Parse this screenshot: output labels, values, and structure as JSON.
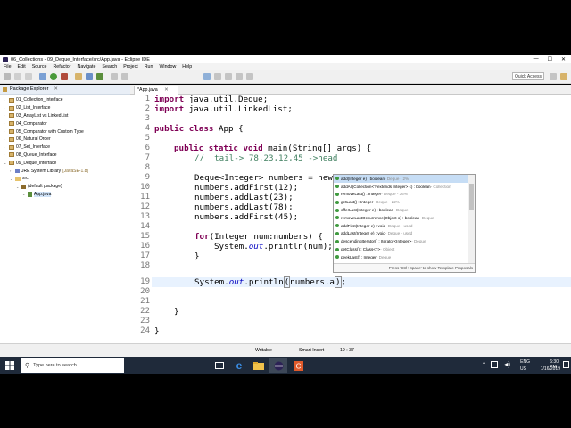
{
  "window": {
    "title": "06_Collections - 09_Deque_Interface/src/App.java - Eclipse IDE",
    "controls": [
      "—",
      "☐",
      "✕"
    ]
  },
  "menu": [
    "File",
    "Edit",
    "Source",
    "Refactor",
    "Navigate",
    "Search",
    "Project",
    "Run",
    "Window",
    "Help"
  ],
  "toolbar": {
    "quick_access": "Quick Access"
  },
  "package_explorer": {
    "title": "Package Explorer",
    "items": [
      {
        "label": "01_Collection_Interface",
        "indent": 0,
        "type": "project"
      },
      {
        "label": "02_List_Interface",
        "indent": 0,
        "type": "project"
      },
      {
        "label": "03_ArrayList vs LinkedList",
        "indent": 0,
        "type": "project"
      },
      {
        "label": "04_Comparator",
        "indent": 0,
        "type": "project"
      },
      {
        "label": "05_Comparator with Custom Type",
        "indent": 0,
        "type": "project"
      },
      {
        "label": "06_Natural Order",
        "indent": 0,
        "type": "project"
      },
      {
        "label": "07_Set_Interface",
        "indent": 0,
        "type": "project"
      },
      {
        "label": "08_Queue_Interface",
        "indent": 0,
        "type": "project"
      },
      {
        "label": "09_Deque_Interface",
        "indent": 0,
        "type": "project"
      },
      {
        "label": "JRE System Library",
        "suffix": "[JavaSE-1.8]",
        "indent": 1,
        "type": "lib"
      },
      {
        "label": "src",
        "indent": 1,
        "type": "src"
      },
      {
        "label": "(default package)",
        "indent": 2,
        "type": "pkg"
      },
      {
        "label": "App.java",
        "indent": 3,
        "type": "java",
        "selected": true
      }
    ]
  },
  "editor": {
    "tab_label": "*App.java",
    "line_numbers": [
      "1",
      "2",
      "3",
      "4",
      "5",
      "6",
      "7",
      "8",
      "9",
      "10",
      "11",
      "12",
      "13",
      "14",
      "15",
      "16",
      "17",
      "18",
      "19",
      "20",
      "21",
      "22",
      "23",
      "24"
    ],
    "lines": {
      "l1_kw": "import",
      "l1_rest": " java.util.Deque;",
      "l2_kw": "import",
      "l2_rest": " java.util.LinkedList;",
      "l4_kw1": "public",
      "l4_kw2": "class",
      "l4_rest": " App {",
      "l6_kw1": "public",
      "l6_kw2": "static",
      "l6_kw3": "void",
      "l6_rest": " main(String[] args) {",
      "l7_cm": "//  tail-> 78,23,12,45 ->head",
      "l9": "Deque<Integer> numbers = new",
      "l10": "numbers.addFirst(12);",
      "l11": "numbers.addLast(23);",
      "l12": "numbers.addLast(78);",
      "l13": "numbers.addFirst(45);",
      "l15_kw": "for",
      "l15_rest": "(Integer num:numbers) {",
      "l16_a": "System.",
      "l16_it": "out",
      "l16_b": ".println(num);",
      "l17": "}",
      "l19_a": "System.",
      "l19_it": "out",
      "l19_b": ".println",
      "l19_paren": "(",
      "l19_c": "numbers.a",
      "l19_close": ")",
      "l19_end": ";",
      "l22": "}",
      "l24": "}"
    }
  },
  "autocomplete": {
    "items": [
      {
        "sig": "add(Integer e) : boolean",
        "src": " - Deque - 2%"
      },
      {
        "sig": "addAll(Collection<? extends Integer> c) : boolean",
        "src": " - Collection"
      },
      {
        "sig": "removeLast() : Integer",
        "src": " - Deque - 36%"
      },
      {
        "sig": "getLast() : Integer",
        "src": " - Deque - 22%"
      },
      {
        "sig": "offerLast(Integer e) : boolean",
        "src": " - Deque"
      },
      {
        "sig": "removeLastOccurrence(Object o) : boolean",
        "src": " - Deque"
      },
      {
        "sig": "addFirst(Integer e) : void",
        "src": " - Deque - used"
      },
      {
        "sig": "addLast(Integer e) : void",
        "src": " - Deque - used"
      },
      {
        "sig": "descendingIterator() : Iterator<Integer>",
        "src": " - Deque"
      },
      {
        "sig": "getClass() : Class<?>",
        "src": " - Object"
      },
      {
        "sig": "peekLast() : Integer",
        "src": " - Deque"
      }
    ],
    "footer": "Press 'Ctrl+Space' to show Template Proposals"
  },
  "status": {
    "writable": "Writable",
    "insert_mode": "Smart Insert",
    "position": "19 : 37"
  },
  "taskbar": {
    "search_placeholder": "Type here to search",
    "lang": "ENG",
    "region": "US",
    "time": "6:30 PM",
    "date": "1/16/2019"
  },
  "colors": {
    "keyword": "#7f0055",
    "comment": "#3f7f5f",
    "field": "#0000c0",
    "current_line": "#e8f2fe",
    "taskbar": "#1f2a3a"
  }
}
